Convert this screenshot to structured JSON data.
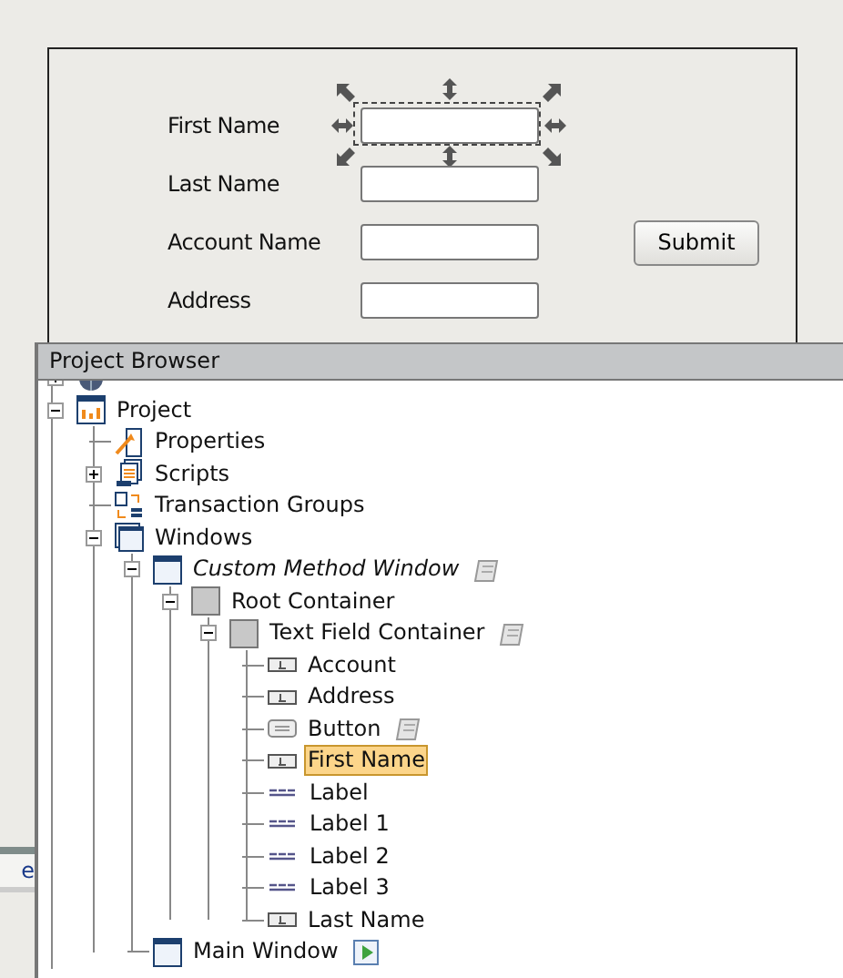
{
  "canvas": {
    "fields": [
      {
        "label": "First Name",
        "selected": true
      },
      {
        "label": "Last Name",
        "selected": false
      },
      {
        "label": "Account Name",
        "selected": false
      },
      {
        "label": "Address",
        "selected": false
      }
    ],
    "button": "Submit"
  },
  "side_panel": {
    "tab": "e"
  },
  "project_browser": {
    "title": "Project Browser",
    "tree": [
      {
        "kind": "globe",
        "expanded": false
      },
      {
        "label": "Project",
        "kind": "project",
        "expanded": true,
        "selected": false,
        "open": false,
        "children": [
          {
            "label": "Properties",
            "kind": "properties",
            "selected": false,
            "open": false
          },
          {
            "label": "Scripts",
            "kind": "scripts",
            "expanded": false,
            "selected": false,
            "open": false
          },
          {
            "label": "Transaction Groups",
            "kind": "transactions",
            "selected": false,
            "open": false
          },
          {
            "label": "Windows",
            "kind": "windows",
            "expanded": true,
            "selected": false,
            "open": false,
            "children": [
              {
                "label": "Custom Method Window",
                "kind": "window",
                "expanded": true,
                "selected": false,
                "open": true,
                "has_script": true,
                "children": [
                  {
                    "label": "Root Container",
                    "kind": "container",
                    "expanded": true,
                    "selected": false,
                    "open": false,
                    "children": [
                      {
                        "label": "Text Field Container",
                        "kind": "container",
                        "expanded": true,
                        "selected": false,
                        "open": false,
                        "has_script": true,
                        "children": [
                          {
                            "label": "Account",
                            "kind": "textfield",
                            "selected": false,
                            "open": false
                          },
                          {
                            "label": "Address",
                            "kind": "textfield",
                            "selected": false,
                            "open": false
                          },
                          {
                            "label": "Button",
                            "kind": "button",
                            "selected": false,
                            "open": false,
                            "has_script": true
                          },
                          {
                            "label": "First Name",
                            "kind": "textfield",
                            "selected": true,
                            "open": false
                          },
                          {
                            "label": "Label",
                            "kind": "label",
                            "selected": false,
                            "open": false
                          },
                          {
                            "label": "Label 1",
                            "kind": "label",
                            "selected": false,
                            "open": false
                          },
                          {
                            "label": "Label 2",
                            "kind": "label",
                            "selected": false,
                            "open": false
                          },
                          {
                            "label": "Label 3",
                            "kind": "label",
                            "selected": false,
                            "open": false
                          },
                          {
                            "label": "Last Name",
                            "kind": "textfield",
                            "selected": false,
                            "open": false
                          }
                        ]
                      }
                    ]
                  }
                ]
              },
              {
                "label": "Main Window",
                "kind": "window",
                "selected": false,
                "open": false,
                "startup": true
              }
            ]
          }
        ]
      }
    ]
  }
}
